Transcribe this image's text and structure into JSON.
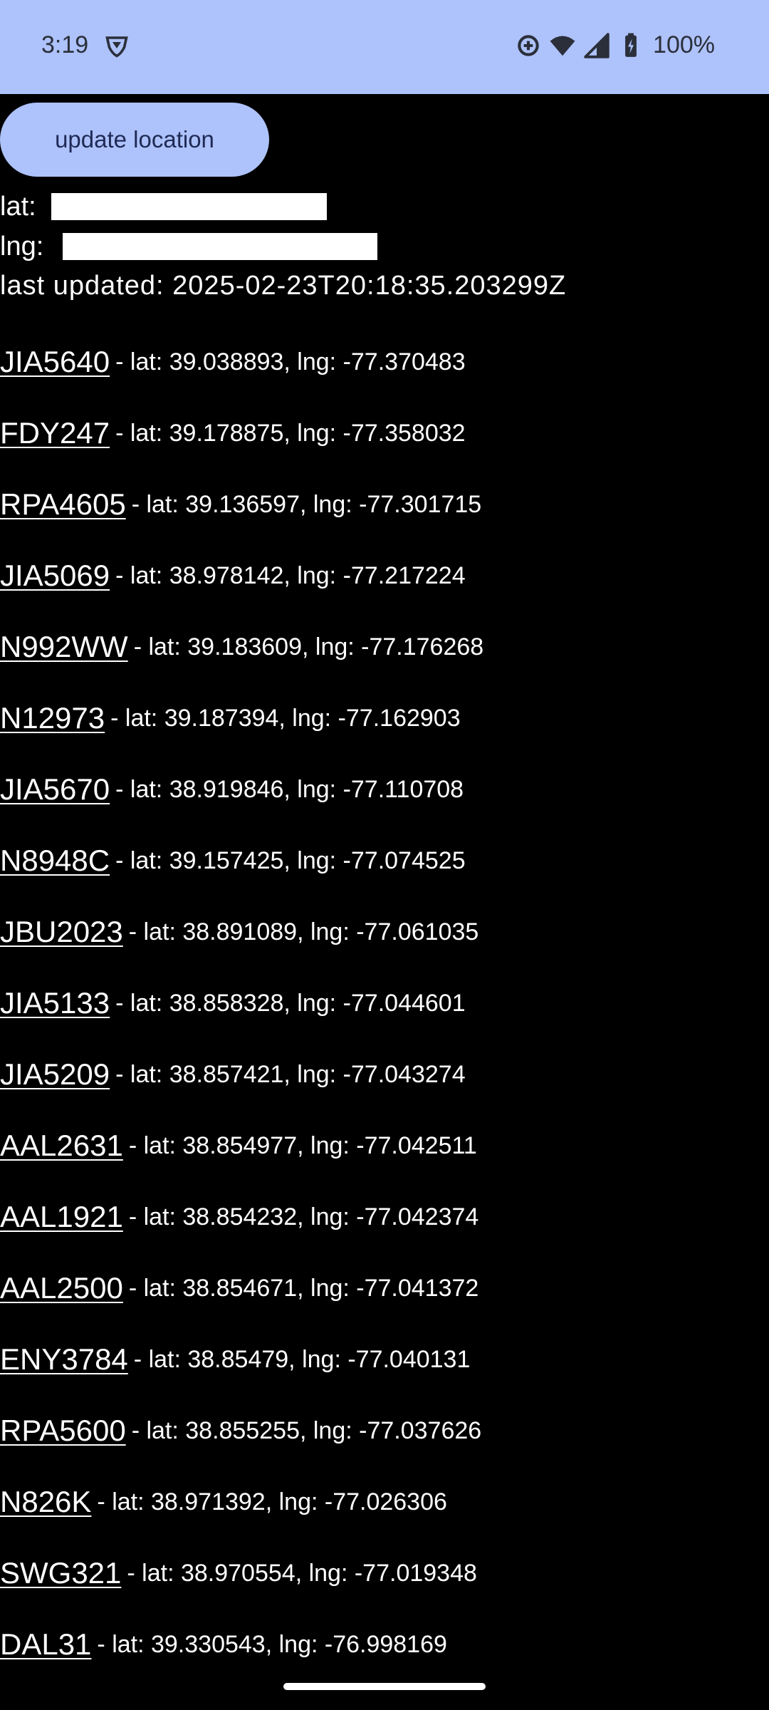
{
  "status_bar": {
    "time": "3:19",
    "battery": "100%",
    "icons": [
      "vpn-shield-icon",
      "data-saver-icon",
      "wifi-icon",
      "cell-signal-icon",
      "battery-charging-icon"
    ]
  },
  "controls": {
    "update_button_label": "update location",
    "lat_label": "lat:",
    "lng_label": "lng:",
    "last_updated": "last updated: 2025-02-23T20:18:35.203299Z"
  },
  "flights": [
    {
      "callsign": "JIA5640",
      "coords": "- lat: 39.038893, lng: -77.370483"
    },
    {
      "callsign": "FDY247",
      "coords": "- lat: 39.178875, lng: -77.358032"
    },
    {
      "callsign": "RPA4605",
      "coords": "- lat: 39.136597, lng: -77.301715"
    },
    {
      "callsign": "JIA5069",
      "coords": "- lat: 38.978142, lng: -77.217224"
    },
    {
      "callsign": "N992WW",
      "coords": "- lat: 39.183609, lng: -77.176268"
    },
    {
      "callsign": "N12973",
      "coords": "- lat: 39.187394, lng: -77.162903"
    },
    {
      "callsign": "JIA5670",
      "coords": "- lat: 38.919846, lng: -77.110708"
    },
    {
      "callsign": "N8948C",
      "coords": "- lat: 39.157425, lng: -77.074525"
    },
    {
      "callsign": "JBU2023",
      "coords": "- lat: 38.891089, lng: -77.061035"
    },
    {
      "callsign": "JIA5133",
      "coords": "- lat: 38.858328, lng: -77.044601"
    },
    {
      "callsign": "JIA5209",
      "coords": "- lat: 38.857421, lng: -77.043274"
    },
    {
      "callsign": "AAL2631",
      "coords": "- lat: 38.854977, lng: -77.042511"
    },
    {
      "callsign": "AAL1921",
      "coords": "- lat: 38.854232, lng: -77.042374"
    },
    {
      "callsign": "AAL2500",
      "coords": "- lat: 38.854671, lng: -77.041372"
    },
    {
      "callsign": "ENY3784",
      "coords": "- lat: 38.85479, lng: -77.040131"
    },
    {
      "callsign": "RPA5600",
      "coords": "- lat: 38.855255, lng: -77.037626"
    },
    {
      "callsign": "N826K",
      "coords": "- lat: 38.971392, lng: -77.026306"
    },
    {
      "callsign": "SWG321",
      "coords": "- lat: 38.970554, lng: -77.019348"
    },
    {
      "callsign": "DAL31",
      "coords": "- lat: 39.330543, lng: -76.998169"
    }
  ],
  "colors": {
    "accent": "#aec2fb",
    "background": "#000000",
    "text": "#ffffff"
  }
}
